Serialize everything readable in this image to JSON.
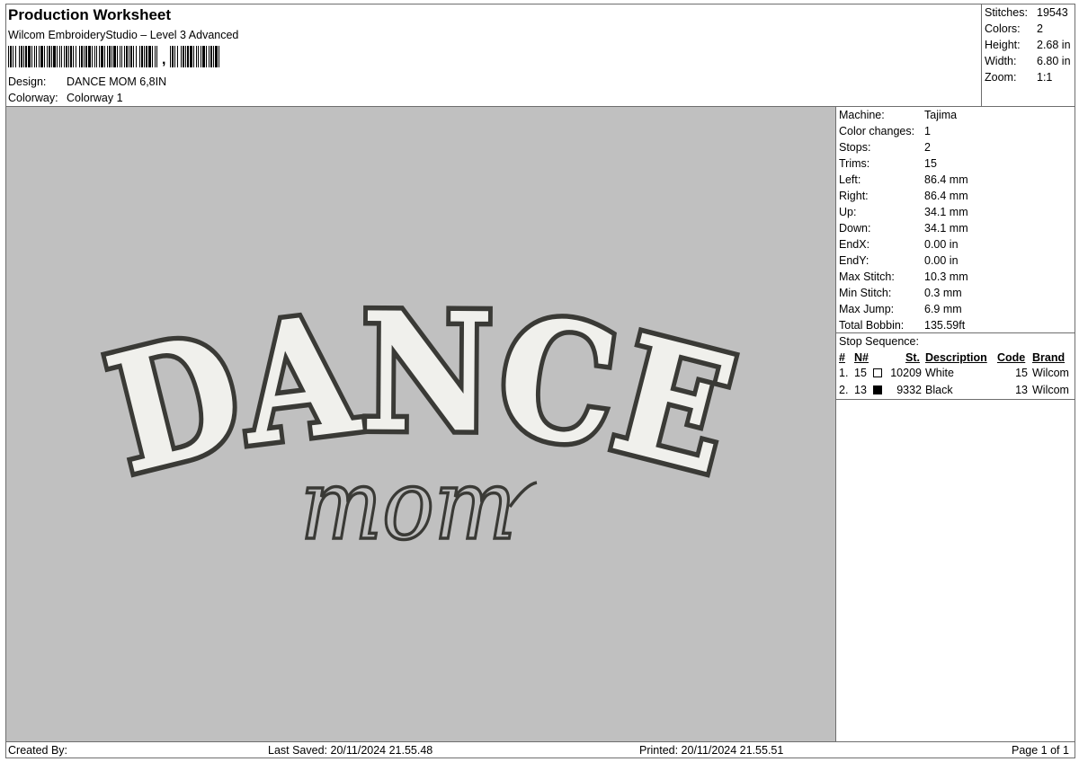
{
  "header": {
    "title": "Production Worksheet",
    "software": "Wilcom EmbroideryStudio – Level 3 Advanced",
    "barcode_suffix": ",",
    "design_label": "Design:",
    "design_value": "DANCE MOM 6,8IN",
    "colorway_label": "Colorway:",
    "colorway_value": "Colorway 1"
  },
  "summary": [
    {
      "label": "Stitches:",
      "value": "19543"
    },
    {
      "label": "Colors:",
      "value": "2"
    },
    {
      "label": "Height:",
      "value": "2.68 in"
    },
    {
      "label": "Width:",
      "value": "6.80 in"
    },
    {
      "label": "Zoom:",
      "value": "1:1"
    }
  ],
  "machine_info": [
    {
      "label": "Machine:",
      "value": "Tajima"
    },
    {
      "label": "Color changes:",
      "value": "1"
    },
    {
      "label": "Stops:",
      "value": "2"
    },
    {
      "label": "Trims:",
      "value": "15"
    },
    {
      "label": "Left:",
      "value": "86.4 mm"
    },
    {
      "label": "Right:",
      "value": "86.4 mm"
    },
    {
      "label": "Up:",
      "value": "34.1 mm"
    },
    {
      "label": "Down:",
      "value": "34.1 mm"
    },
    {
      "label": "EndX:",
      "value": "0.00 in"
    },
    {
      "label": "EndY:",
      "value": "0.00 in"
    },
    {
      "label": "Max Stitch:",
      "value": "10.3 mm"
    },
    {
      "label": "Min Stitch:",
      "value": "0.3 mm"
    },
    {
      "label": "Max Jump:",
      "value": "6.9 mm"
    },
    {
      "label": "Total Bobbin:",
      "value": "135.59ft"
    }
  ],
  "stop_sequence": {
    "title": "Stop Sequence:",
    "headers": {
      "num": "#",
      "n": "N#",
      "st": "St.",
      "description": "Description",
      "code": "Code",
      "brand": "Brand"
    },
    "rows": [
      {
        "num": "1.",
        "n": "15",
        "swatch_color": "#ffffff",
        "st": "10209",
        "description": "White",
        "code": "15",
        "brand": "Wilcom"
      },
      {
        "num": "2.",
        "n": "13",
        "swatch_color": "#000000",
        "st": "9332",
        "description": "Black",
        "code": "13",
        "brand": "Wilcom"
      }
    ]
  },
  "design_preview": {
    "line1": "DANCE",
    "line2": "mom",
    "fill_color": "#f0f0ec",
    "outline_color": "#3a3a36",
    "background": "#c0c0c0"
  },
  "footer": {
    "created_by": "Created By:",
    "last_saved": "Last Saved: 20/11/2024 21.55.48",
    "printed": "Printed: 20/11/2024 21.55.51",
    "page": "Page 1 of 1"
  }
}
